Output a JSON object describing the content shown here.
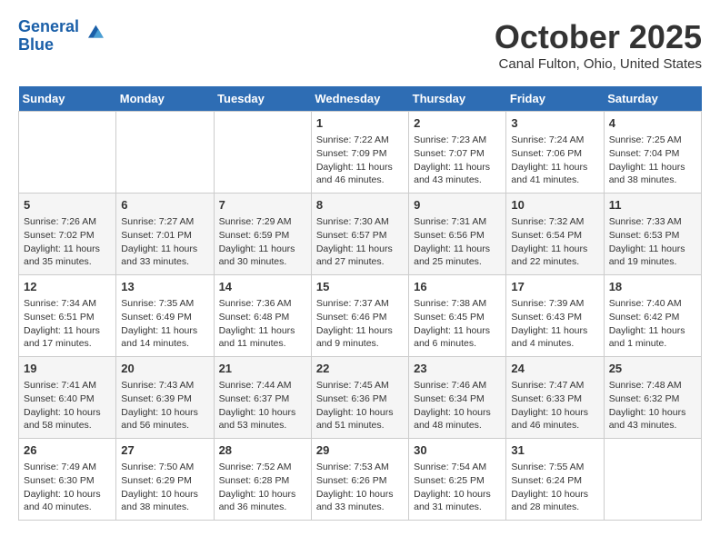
{
  "header": {
    "logo_line1": "General",
    "logo_line2": "Blue",
    "month": "October 2025",
    "location": "Canal Fulton, Ohio, United States"
  },
  "weekdays": [
    "Sunday",
    "Monday",
    "Tuesday",
    "Wednesday",
    "Thursday",
    "Friday",
    "Saturday"
  ],
  "weeks": [
    [
      {
        "day": "",
        "info": ""
      },
      {
        "day": "",
        "info": ""
      },
      {
        "day": "",
        "info": ""
      },
      {
        "day": "1",
        "info": "Sunrise: 7:22 AM\nSunset: 7:09 PM\nDaylight: 11 hours and 46 minutes."
      },
      {
        "day": "2",
        "info": "Sunrise: 7:23 AM\nSunset: 7:07 PM\nDaylight: 11 hours and 43 minutes."
      },
      {
        "day": "3",
        "info": "Sunrise: 7:24 AM\nSunset: 7:06 PM\nDaylight: 11 hours and 41 minutes."
      },
      {
        "day": "4",
        "info": "Sunrise: 7:25 AM\nSunset: 7:04 PM\nDaylight: 11 hours and 38 minutes."
      }
    ],
    [
      {
        "day": "5",
        "info": "Sunrise: 7:26 AM\nSunset: 7:02 PM\nDaylight: 11 hours and 35 minutes."
      },
      {
        "day": "6",
        "info": "Sunrise: 7:27 AM\nSunset: 7:01 PM\nDaylight: 11 hours and 33 minutes."
      },
      {
        "day": "7",
        "info": "Sunrise: 7:29 AM\nSunset: 6:59 PM\nDaylight: 11 hours and 30 minutes."
      },
      {
        "day": "8",
        "info": "Sunrise: 7:30 AM\nSunset: 6:57 PM\nDaylight: 11 hours and 27 minutes."
      },
      {
        "day": "9",
        "info": "Sunrise: 7:31 AM\nSunset: 6:56 PM\nDaylight: 11 hours and 25 minutes."
      },
      {
        "day": "10",
        "info": "Sunrise: 7:32 AM\nSunset: 6:54 PM\nDaylight: 11 hours and 22 minutes."
      },
      {
        "day": "11",
        "info": "Sunrise: 7:33 AM\nSunset: 6:53 PM\nDaylight: 11 hours and 19 minutes."
      }
    ],
    [
      {
        "day": "12",
        "info": "Sunrise: 7:34 AM\nSunset: 6:51 PM\nDaylight: 11 hours and 17 minutes."
      },
      {
        "day": "13",
        "info": "Sunrise: 7:35 AM\nSunset: 6:49 PM\nDaylight: 11 hours and 14 minutes."
      },
      {
        "day": "14",
        "info": "Sunrise: 7:36 AM\nSunset: 6:48 PM\nDaylight: 11 hours and 11 minutes."
      },
      {
        "day": "15",
        "info": "Sunrise: 7:37 AM\nSunset: 6:46 PM\nDaylight: 11 hours and 9 minutes."
      },
      {
        "day": "16",
        "info": "Sunrise: 7:38 AM\nSunset: 6:45 PM\nDaylight: 11 hours and 6 minutes."
      },
      {
        "day": "17",
        "info": "Sunrise: 7:39 AM\nSunset: 6:43 PM\nDaylight: 11 hours and 4 minutes."
      },
      {
        "day": "18",
        "info": "Sunrise: 7:40 AM\nSunset: 6:42 PM\nDaylight: 11 hours and 1 minute."
      }
    ],
    [
      {
        "day": "19",
        "info": "Sunrise: 7:41 AM\nSunset: 6:40 PM\nDaylight: 10 hours and 58 minutes."
      },
      {
        "day": "20",
        "info": "Sunrise: 7:43 AM\nSunset: 6:39 PM\nDaylight: 10 hours and 56 minutes."
      },
      {
        "day": "21",
        "info": "Sunrise: 7:44 AM\nSunset: 6:37 PM\nDaylight: 10 hours and 53 minutes."
      },
      {
        "day": "22",
        "info": "Sunrise: 7:45 AM\nSunset: 6:36 PM\nDaylight: 10 hours and 51 minutes."
      },
      {
        "day": "23",
        "info": "Sunrise: 7:46 AM\nSunset: 6:34 PM\nDaylight: 10 hours and 48 minutes."
      },
      {
        "day": "24",
        "info": "Sunrise: 7:47 AM\nSunset: 6:33 PM\nDaylight: 10 hours and 46 minutes."
      },
      {
        "day": "25",
        "info": "Sunrise: 7:48 AM\nSunset: 6:32 PM\nDaylight: 10 hours and 43 minutes."
      }
    ],
    [
      {
        "day": "26",
        "info": "Sunrise: 7:49 AM\nSunset: 6:30 PM\nDaylight: 10 hours and 40 minutes."
      },
      {
        "day": "27",
        "info": "Sunrise: 7:50 AM\nSunset: 6:29 PM\nDaylight: 10 hours and 38 minutes."
      },
      {
        "day": "28",
        "info": "Sunrise: 7:52 AM\nSunset: 6:28 PM\nDaylight: 10 hours and 36 minutes."
      },
      {
        "day": "29",
        "info": "Sunrise: 7:53 AM\nSunset: 6:26 PM\nDaylight: 10 hours and 33 minutes."
      },
      {
        "day": "30",
        "info": "Sunrise: 7:54 AM\nSunset: 6:25 PM\nDaylight: 10 hours and 31 minutes."
      },
      {
        "day": "31",
        "info": "Sunrise: 7:55 AM\nSunset: 6:24 PM\nDaylight: 10 hours and 28 minutes."
      },
      {
        "day": "",
        "info": ""
      }
    ]
  ]
}
